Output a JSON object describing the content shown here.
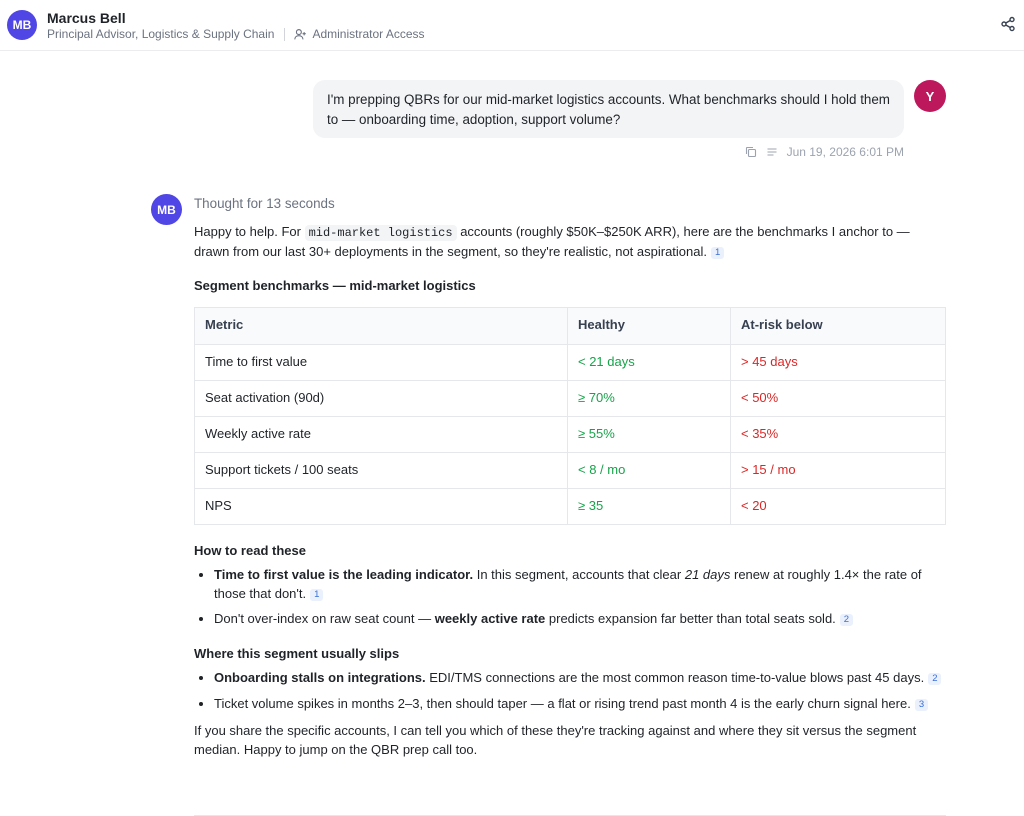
{
  "header": {
    "avatar_initials": "MB",
    "name": "Marcus Bell",
    "title": "Principal Advisor, Logistics & Supply Chain",
    "access": "Administrator Access",
    "share_icon": "share-icon"
  },
  "user_message": {
    "avatar_initial": "Y",
    "text": "I'm prepping QBRs for our mid-market logistics accounts. What benchmarks should I hold them to — onboarding time, adoption, support volume?",
    "timestamp": "Jun 19, 2026 6:01 PM"
  },
  "assistant": {
    "avatar_initials": "MB",
    "thought": "Thought for 13 seconds",
    "intro": {
      "pre": "Happy to help. For ",
      "code": "mid-market logistics",
      "post": " accounts (roughly $50K–$250K ARR), here are the benchmarks I anchor to — drawn from our last 30+ deployments in the segment, so they're realistic, not aspirational.",
      "cite": "1"
    },
    "table_heading": "Segment benchmarks — mid-market logistics",
    "table": {
      "headers": [
        "Metric",
        "Healthy",
        "At-risk below"
      ],
      "rows": [
        [
          "Time to first value",
          "< 21 days",
          "> 45 days"
        ],
        [
          "Seat activation (90d)",
          "≥ 70%",
          "< 50%"
        ],
        [
          "Weekly active rate",
          "≥ 55%",
          "< 35%"
        ],
        [
          "Support tickets / 100 seats",
          "< 8 / mo",
          "> 15 / mo"
        ],
        [
          "NPS",
          "≥ 35",
          "< 20"
        ]
      ]
    },
    "read_heading": "How to read these",
    "read_bullets": [
      {
        "bold": "Time to first value is the leading indicator.",
        "text1": " In this segment, accounts that clear ",
        "italic": "21 days",
        "text2": " renew at roughly 1.4× the rate of those that don't.",
        "cite": "1"
      },
      {
        "text1": "Don't over-index on raw seat count — ",
        "bold": "weekly active rate",
        "text2": " predicts expansion far better than total seats sold.",
        "cite": "2"
      }
    ],
    "slips_heading": "Where this segment usually slips",
    "slips_bullets": [
      {
        "bold": "Onboarding stalls on integrations.",
        "text": " EDI/TMS connections are the most common reason time-to-value blows past 45 days.",
        "cite": "2"
      },
      {
        "text": "Ticket volume spikes in months 2–3, then should taper — a flat or rising trend past month 4 is the early churn signal here.",
        "cite": "3"
      }
    ],
    "closing": "If you share the specific accounts, I can tell you which of these they're tracking against and where they sit versus the segment median. Happy to jump on the QBR prep call too."
  },
  "colors": {
    "avatar_mb": "#4f46e5",
    "avatar_y": "#be185d",
    "healthy": "#16a34a",
    "at_risk": "#dc2626",
    "citation": "#3b6fd8"
  }
}
